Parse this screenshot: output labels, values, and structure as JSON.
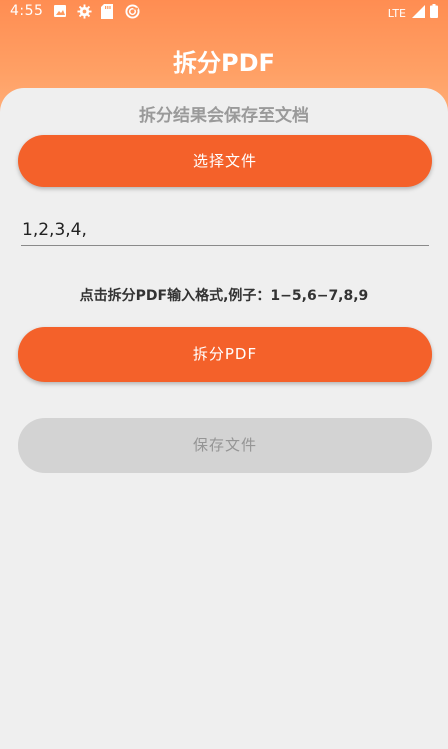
{
  "status_bar": {
    "time": "4:55",
    "network": "LTE",
    "icons": [
      "image-icon",
      "gear-icon",
      "sd-card-icon",
      "sync-icon",
      "signal-icon",
      "battery-icon"
    ]
  },
  "header": {
    "title": "拆分PDF"
  },
  "main": {
    "subtitle": "拆分结果会保存至文档",
    "select_button_label": "选择文件",
    "page_input_value": "1,2,3,4,",
    "hint": "点击拆分PDF输入格式,例子：1−5,6−7,8,9",
    "split_button_label": "拆分PDF",
    "save_button_label": "保存文件"
  },
  "colors": {
    "accent": "#f4612a",
    "header_gradient_top": "#ff8d52",
    "disabled_button": "#d3d3d3",
    "background": "#efefef"
  }
}
